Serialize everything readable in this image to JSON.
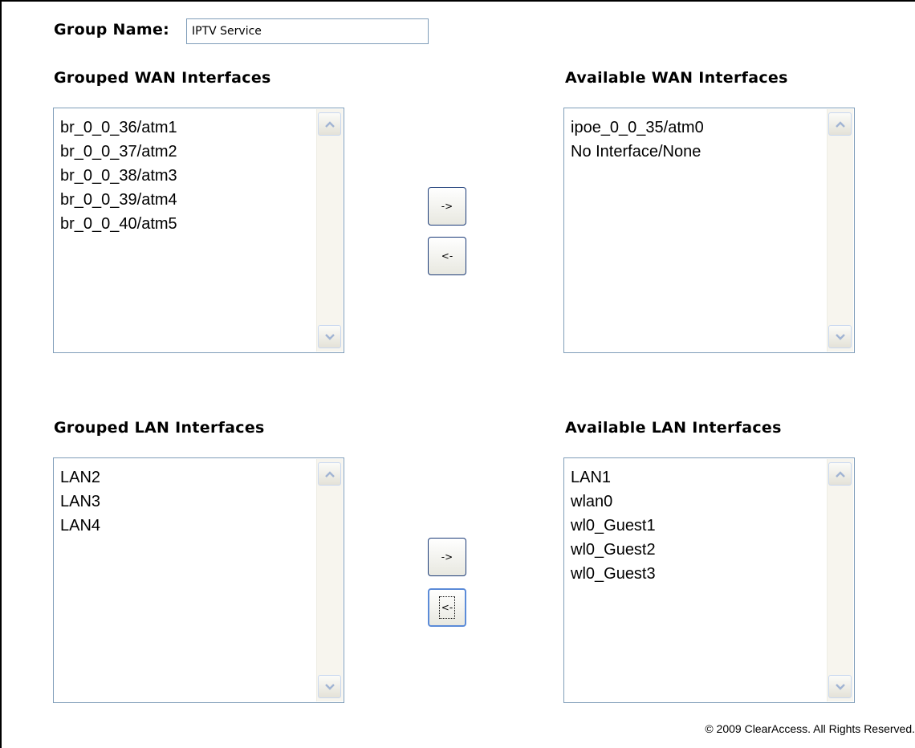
{
  "group_name": {
    "label": "Group Name:",
    "value": "IPTV Service"
  },
  "wan": {
    "grouped_heading": "Grouped WAN Interfaces",
    "available_heading": "Available WAN Interfaces",
    "grouped_items": [
      "br_0_0_36/atm1",
      "br_0_0_37/atm2",
      "br_0_0_38/atm3",
      "br_0_0_39/atm4",
      "br_0_0_40/atm5"
    ],
    "available_items": [
      "ipoe_0_0_35/atm0",
      "No Interface/None"
    ],
    "add_label": "->",
    "remove_label": "<-"
  },
  "lan": {
    "grouped_heading": "Grouped LAN Interfaces",
    "available_heading": "Available LAN Interfaces",
    "grouped_items": [
      "LAN2",
      "LAN3",
      "LAN4"
    ],
    "available_items": [
      "LAN1",
      "wlan0",
      "wl0_Guest1",
      "wl0_Guest2",
      "wl0_Guest3"
    ],
    "add_label": "->",
    "remove_label": "<-"
  },
  "footer": {
    "copyright": "© 2009 ClearAccess. All Rights Reserved."
  },
  "icons": {
    "scroll_up": "chevron-up-icon",
    "scroll_down": "chevron-down-icon"
  },
  "colors": {
    "listbox_border": "#7f9db9",
    "scroll_arrow": "#a1b4d3",
    "button_border": "#1b3b78",
    "focus_border": "#5b8bd8"
  }
}
